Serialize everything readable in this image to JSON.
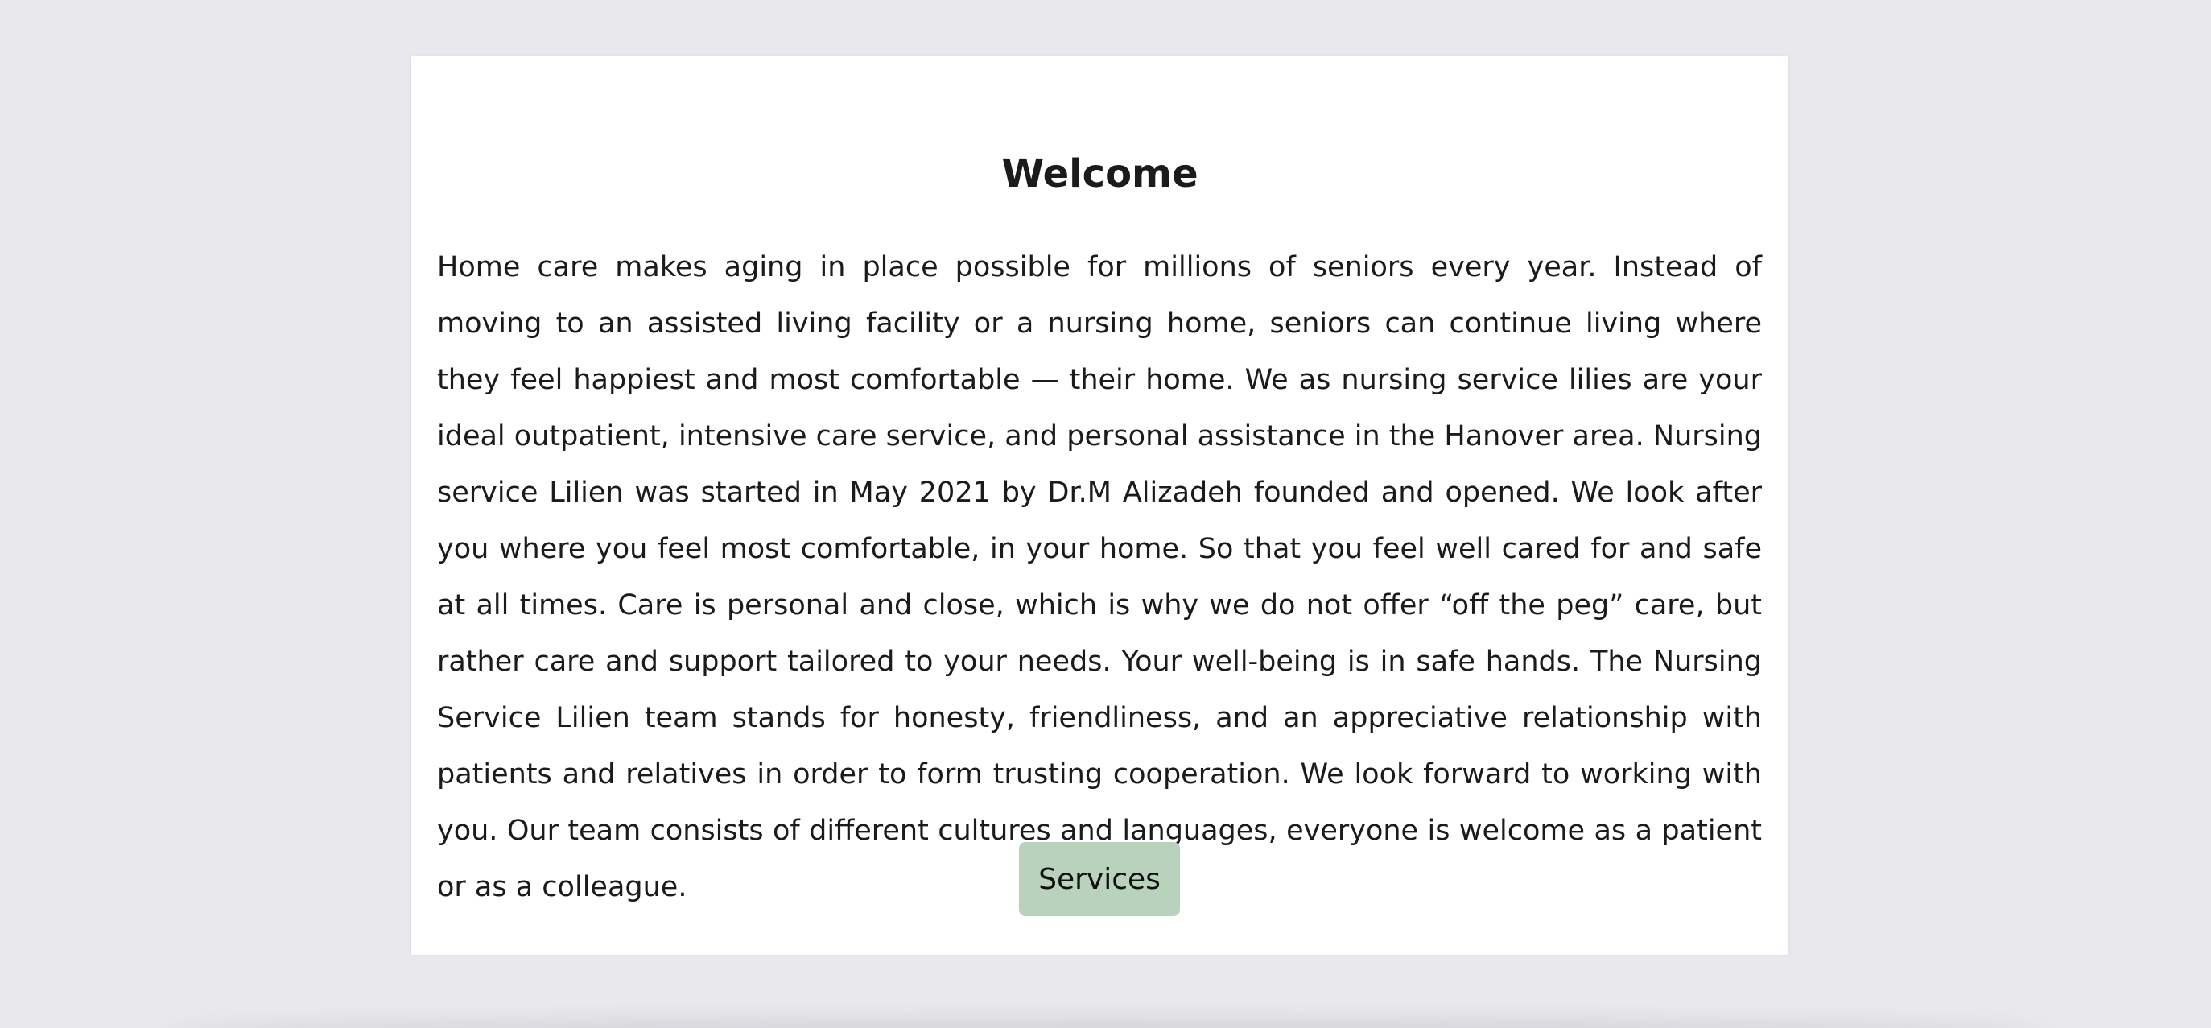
{
  "card": {
    "title": "Welcome",
    "paragraph": "Home care makes aging in place possible for millions of seniors every year. Instead of moving to an assisted living facility or a nursing home, seniors can continue living where they feel happiest and most comfortable — their home. We as nursing service lilies are your ideal outpatient, intensive care service, and personal assistance in the Hanover area. Nursing service Lilien was started in May 2021 by Dr.M Alizadeh founded and opened. We look after you where you feel most comfortable, in your home. So that you feel well cared for and safe at all times. Care is personal and close, which is why we do not offer “off the peg” care, but rather care and support tailored to your needs. Your well-being is in safe hands. The Nursing Service Lilien team stands for honesty, friendliness, and an appreciative relationship with patients and relatives in order to form trusting cooperation. We look forward to working with you. Our team consists of different cultures and languages, everyone is welcome as a patient or as a colleague.",
    "button_label": "Services"
  },
  "colors": {
    "page_background": "#e9e8ed",
    "card_background": "#ffffff",
    "button_background": "#b9d2bc",
    "text": "#1b1b1b"
  }
}
